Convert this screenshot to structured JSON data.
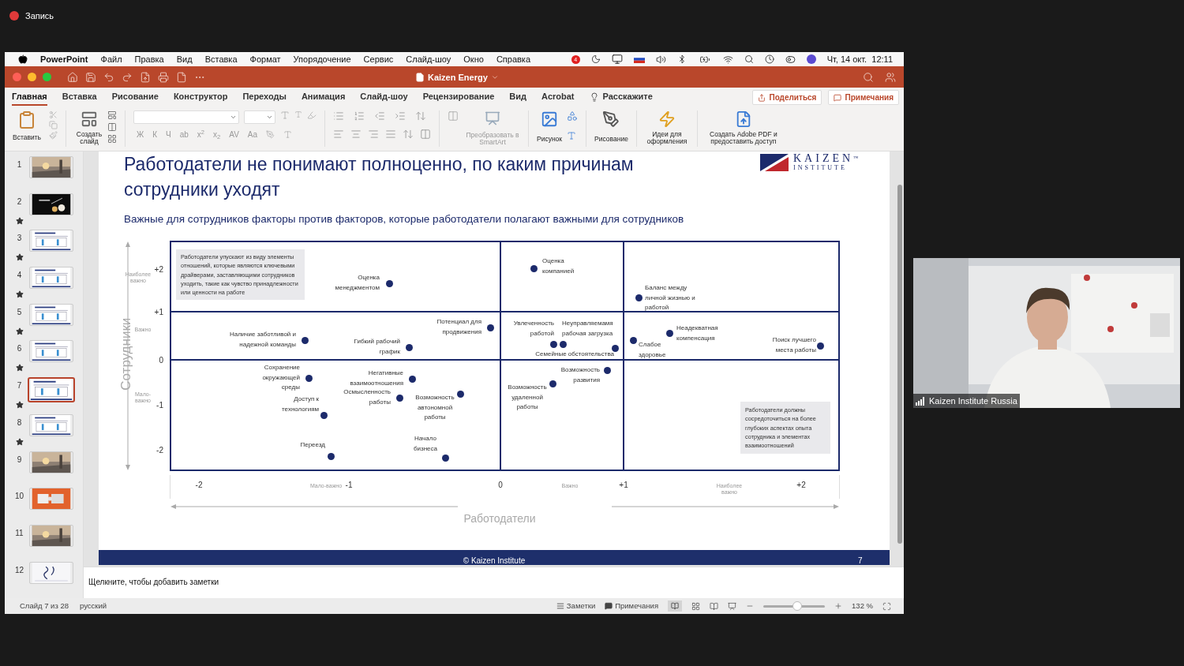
{
  "recording": {
    "label": "Запись"
  },
  "menu_bar": {
    "app": "PowerPoint",
    "items": [
      "Файл",
      "Правка",
      "Вид",
      "Вставка",
      "Формат",
      "Упорядочение",
      "Сервис",
      "Слайд-шоу",
      "Окно",
      "Справка"
    ],
    "badge": "4",
    "clock": "Чт, 14 окт.  12:11"
  },
  "window": {
    "title": "Kaizen Energy"
  },
  "tabs": [
    {
      "label": "Главная",
      "selected": true
    },
    {
      "label": "Вставка",
      "selected": false
    },
    {
      "label": "Рисование",
      "selected": false
    },
    {
      "label": "Конструктор",
      "selected": false
    },
    {
      "label": "Переходы",
      "selected": false
    },
    {
      "label": "Анимация",
      "selected": false
    },
    {
      "label": "Слайд-шоу",
      "selected": false
    },
    {
      "label": "Рецензирование",
      "selected": false
    },
    {
      "label": "Вид",
      "selected": false
    },
    {
      "label": "Acrobat",
      "selected": false
    }
  ],
  "tell_me": "Расскажите",
  "share_button": "Поделиться",
  "comments_button": "Примечания",
  "ribbon": {
    "paste": "Вставить",
    "new_slide": "Создать слайд",
    "format_buttons": [
      "Ж",
      "К",
      "Ч",
      "ab",
      "x$^{2}$",
      "x$_{2}$",
      "AV",
      "Aa"
    ],
    "smartart": {
      "label": "Преобразовать в SmartArt",
      "disabled": true
    },
    "picture": "Рисунок",
    "drawing": "Рисование",
    "design_ideas": "Идеи для оформления",
    "adobe_pdf": "Создать Adobe PDF и предоставить доступ"
  },
  "slides": [
    {
      "number": "1",
      "starred": false,
      "selected": false
    },
    {
      "number": "2",
      "kind": "dark",
      "starred": true,
      "selected": false
    },
    {
      "number": "3",
      "kind": "document",
      "starred": true,
      "selected": false
    },
    {
      "number": "4",
      "kind": "document",
      "starred": true,
      "selected": false
    },
    {
      "number": "5",
      "kind": "document",
      "starred": true,
      "selected": false
    },
    {
      "number": "6",
      "kind": "document",
      "starred": true,
      "selected": false
    },
    {
      "number": "7",
      "kind": "document",
      "starred": true,
      "selected": true
    },
    {
      "number": "8",
      "kind": "document",
      "starred": true,
      "selected": false
    },
    {
      "number": "9",
      "starred": false,
      "selected": false
    },
    {
      "number": "10",
      "kind": "orange",
      "starred": false,
      "selected": false
    },
    {
      "number": "11",
      "starred": false,
      "selected": false
    },
    {
      "number": "12",
      "kind": "light",
      "starred": false,
      "selected": false
    }
  ],
  "slide": {
    "title": "Работодатели не понимают полноценно, по каким причинам сотрудники уходят",
    "subtitle": "Важные для сотрудников факторы против факторов, которые работодатели полагают важными для сотрудников",
    "logo": {
      "name": "KAIZEN",
      "tm": "™",
      "sub": "INSTITUTE"
    },
    "y_axis": {
      "title": "Сотрудники",
      "ticks": [
        "+2",
        "+1",
        "0",
        "-1",
        "-2"
      ],
      "bands": [
        "Наиболее важно",
        "Важно",
        "Мало-важно"
      ]
    },
    "x_axis": {
      "title": "Работодатели",
      "ticks": [
        "-2",
        "-1",
        "0",
        "+1",
        "+2"
      ],
      "bands": [
        "Мало-важно",
        "Важно",
        "Наиболее важно"
      ]
    },
    "callouts": [
      "Работодатели упускают из виду элементы отношений, которые являются ключевыми драйверами, заставляющими сотрудников уходить, такие как чувство принадлежности или ценности на работе",
      "Работодатели должны сосредоточиться на более глубоких аспектах опыта сотрудника и элементах взаимоотношений"
    ],
    "points": [
      {
        "label": "Оценка менеджментом"
      },
      {
        "label": "Оценка компанией"
      },
      {
        "label": "Баланс между личной жизнью и работой"
      },
      {
        "label": "Наличие заботливой и надежной команды"
      },
      {
        "label": "Гибкий рабочий график"
      },
      {
        "label": "Потенциал для продвижения"
      },
      {
        "label": "Увлеченность работой"
      },
      {
        "label": "Неуправляемамя рабочая загрузка"
      },
      {
        "label": "Семейные обстоятельства"
      },
      {
        "label": "Слабое здоровье"
      },
      {
        "label": "Неадекватная компенсация"
      },
      {
        "label": "Поиск лучшего места работы"
      },
      {
        "label": "Сохранение окружающей среды"
      },
      {
        "label": "Доступ к технологиям"
      },
      {
        "label": "Негативные взаимоотношения"
      },
      {
        "label": "Осмысленность работы"
      },
      {
        "label": "Возможность автономной работы"
      },
      {
        "label": "Возможность удаленной работы"
      },
      {
        "label": "Возможность развития"
      },
      {
        "label": "Переезд"
      },
      {
        "label": "Начало бизнеса"
      }
    ],
    "footer": "© Kaizen Institute",
    "page_number": "7"
  },
  "notes": {
    "placeholder": "Щелкните, чтобы добавить заметки"
  },
  "status_bar": {
    "slide_info": "Слайд 7 из 28",
    "language": "русский",
    "notes": "Заметки",
    "comments": "Примечания",
    "zoom_slider": {
      "level": 0.55
    },
    "zoom": "132 %"
  },
  "video": {
    "name": "Kaizen Institute Russia"
  }
}
